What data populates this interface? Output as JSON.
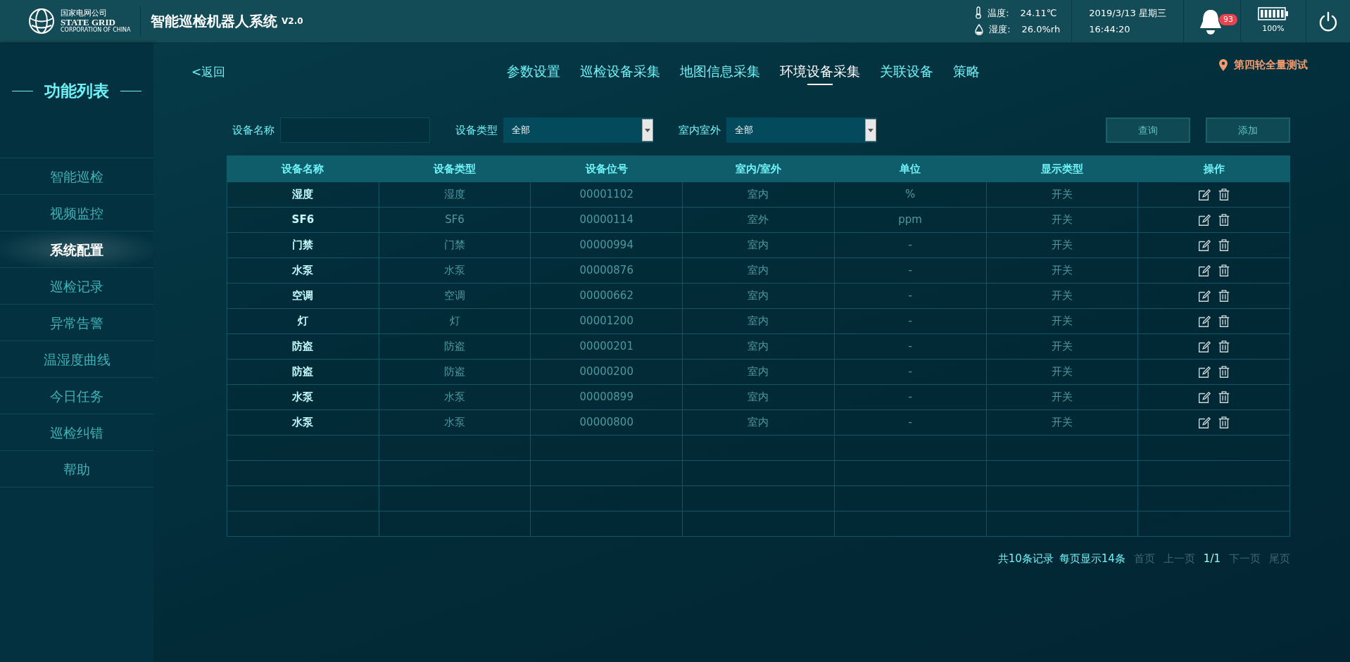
{
  "header": {
    "org_cn": "国家电网公司",
    "org_en": "STATE GRID",
    "org_sub": "CORPORATION OF CHINA",
    "title": "智能巡检机器人系统",
    "version": "V2.0",
    "temperature": {
      "label": "温度:",
      "value": "24.11℃"
    },
    "humidity": {
      "label": "湿度:",
      "value": "26.0%rh"
    },
    "date": "2019/3/13 星期三",
    "time": "16:44:20",
    "alarm_count": "93",
    "battery": {
      "level": 1.0,
      "reading": "100%"
    }
  },
  "sidebar": {
    "title": "功能列表",
    "items": [
      {
        "label": "智能巡检",
        "selected": false
      },
      {
        "label": "视频监控",
        "selected": false
      },
      {
        "label": "系统配置",
        "selected": true
      },
      {
        "label": "巡检记录",
        "selected": false
      },
      {
        "label": "异常告警",
        "selected": false
      },
      {
        "label": "温湿度曲线",
        "selected": false
      },
      {
        "label": "今日任务",
        "selected": false
      },
      {
        "label": "巡检纠错",
        "selected": false
      },
      {
        "label": "帮助",
        "selected": false
      }
    ]
  },
  "back": "<返回",
  "tabs": [
    {
      "label": "参数设置",
      "selected": false
    },
    {
      "label": "巡检设备采集",
      "selected": false
    },
    {
      "label": "地图信息采集",
      "selected": false
    },
    {
      "label": "环境设备采集",
      "selected": true
    },
    {
      "label": "关联设备",
      "selected": false
    },
    {
      "label": "策略",
      "selected": false
    }
  ],
  "location": "第四轮全量测试",
  "filters": [
    {
      "kind": "input",
      "label": "设备名称"
    },
    {
      "kind": "select",
      "label": "设备类型",
      "value": "全部"
    },
    {
      "kind": "select",
      "label": "室内室外",
      "value": "全部"
    }
  ],
  "buttons": [
    "查询",
    "添加"
  ],
  "table": {
    "columns": [
      "设备名称",
      "设备类型",
      "设备位号",
      "室内/室外",
      "单位",
      "显示类型",
      "操作"
    ],
    "rows": [
      [
        "湿度",
        "湿度",
        "00001102",
        "室内",
        "%",
        "开关"
      ],
      [
        "SF6",
        "SF6",
        "00000114",
        "室外",
        "ppm",
        "开关"
      ],
      [
        "门禁",
        "门禁",
        "00000994",
        "室内",
        "-",
        "开关"
      ],
      [
        "水泵",
        "水泵",
        "00000876",
        "室内",
        "-",
        "开关"
      ],
      [
        "空调",
        "空调",
        "00000662",
        "室内",
        "-",
        "开关"
      ],
      [
        "灯",
        "灯",
        "00001200",
        "室内",
        "-",
        "开关"
      ],
      [
        "防盗",
        "防盗",
        "00000201",
        "室内",
        "-",
        "开关"
      ],
      [
        "防盗",
        "防盗",
        "00000200",
        "室内",
        "-",
        "开关"
      ],
      [
        "水泵",
        "水泵",
        "00000899",
        "室内",
        "-",
        "开关"
      ],
      [
        "水泵",
        "水泵",
        "00000800",
        "室内",
        "-",
        "开关"
      ]
    ]
  },
  "pagination": [
    {
      "text": "共10条记录",
      "kind": "info"
    },
    {
      "text": "每页显示14条",
      "kind": "info"
    },
    {
      "text": "首页",
      "kind": "link",
      "disabled": true
    },
    {
      "text": "上一页",
      "kind": "link",
      "disabled": true
    },
    {
      "text": "1/1",
      "kind": "current"
    },
    {
      "text": "下一页",
      "kind": "link",
      "disabled": true
    },
    {
      "text": "尾页",
      "kind": "link",
      "disabled": true
    }
  ]
}
